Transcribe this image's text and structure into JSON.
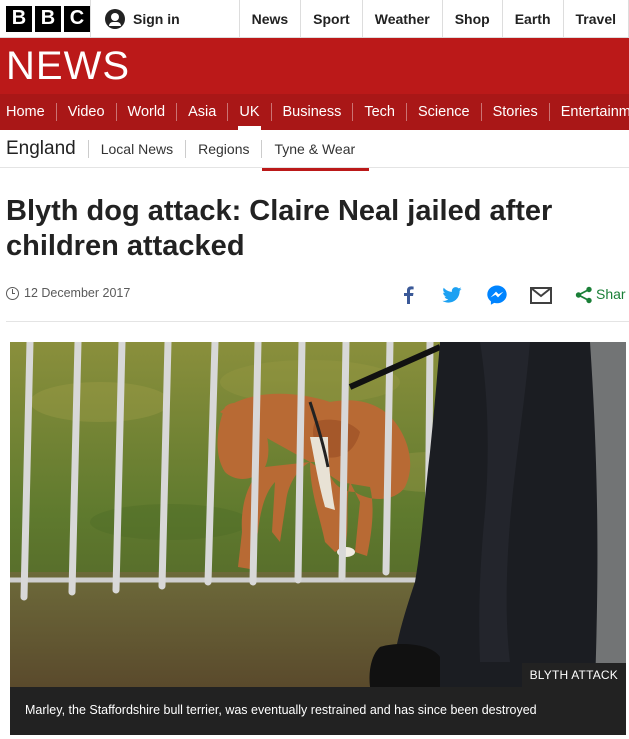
{
  "masthead": {
    "logo_letters": [
      "B",
      "B",
      "C"
    ],
    "signin_label": "Sign in",
    "nav": [
      "News",
      "Sport",
      "Weather",
      "Shop",
      "Earth",
      "Travel"
    ]
  },
  "news_banner": {
    "title": "NEWS",
    "color": "#bb1919"
  },
  "section_nav": {
    "items": [
      "Home",
      "Video",
      "World",
      "Asia",
      "UK",
      "Business",
      "Tech",
      "Science",
      "Stories",
      "Entertainm"
    ],
    "active": "UK"
  },
  "sub_nav": {
    "region": "England",
    "items": [
      "Local News",
      "Regions",
      "Tyne & Wear"
    ],
    "active": "Tyne & Wear"
  },
  "article": {
    "headline": "Blyth dog attack: Claire Neal jailed after children attacked",
    "date": "12 December 2017",
    "share_label": "Shar",
    "share_icons": [
      "facebook-icon",
      "twitter-icon",
      "messenger-icon",
      "email-icon",
      "share-icon"
    ],
    "image_tag": "BLYTH ATTACK",
    "caption": "Marley, the Staffordshire bull terrier, was eventually restrained and has since been destroyed"
  }
}
